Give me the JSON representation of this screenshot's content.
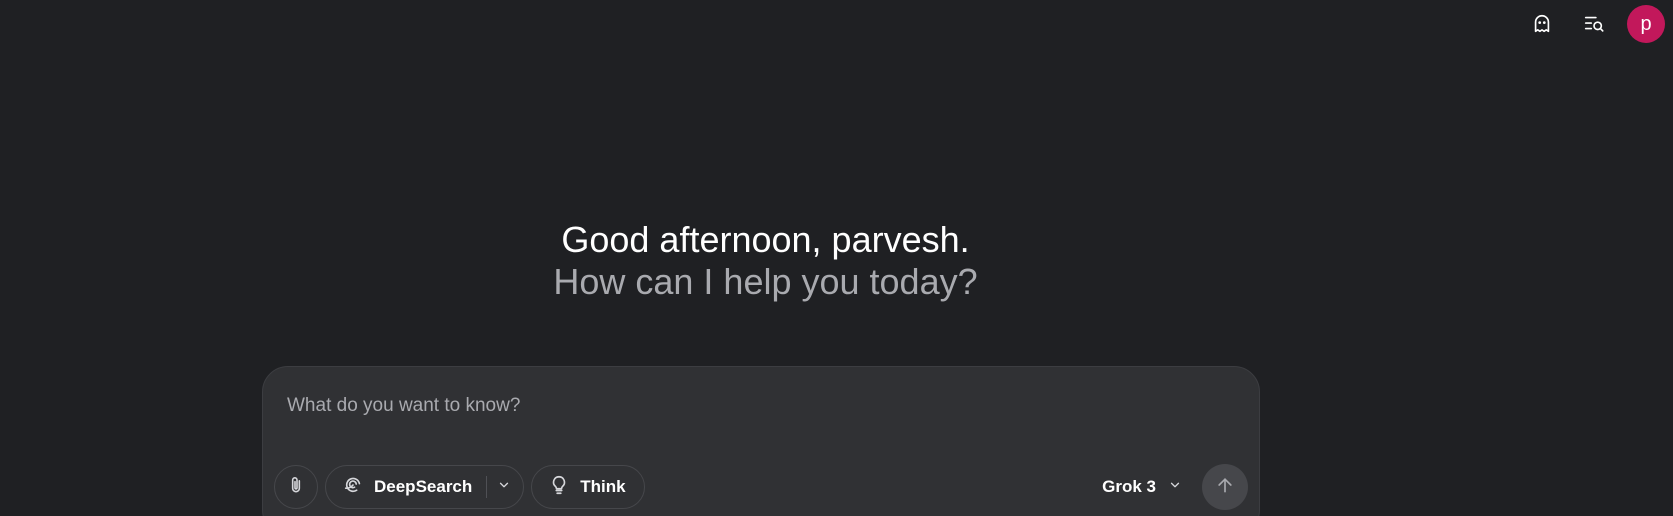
{
  "header": {
    "icons": [
      "ghost-icon",
      "history-search-icon"
    ],
    "avatar_initial": "p",
    "avatar_color": "#c2185b"
  },
  "greeting": {
    "title": "Good afternoon, parvesh.",
    "subtitle": "How can I help you today?"
  },
  "composer": {
    "placeholder": "What do you want to know?",
    "toolbar": {
      "attach_icon": "paperclip-icon",
      "deepsearch_label": "DeepSearch",
      "deepsearch_icon": "deepsearch-swirl-icon",
      "think_label": "Think",
      "think_icon": "lightbulb-icon",
      "model_label": "Grok 3",
      "send_icon": "arrow-up-icon"
    }
  },
  "colors": {
    "background": "#1f2023",
    "composer_background": "#303134",
    "muted_text": "#a9aaaf"
  }
}
